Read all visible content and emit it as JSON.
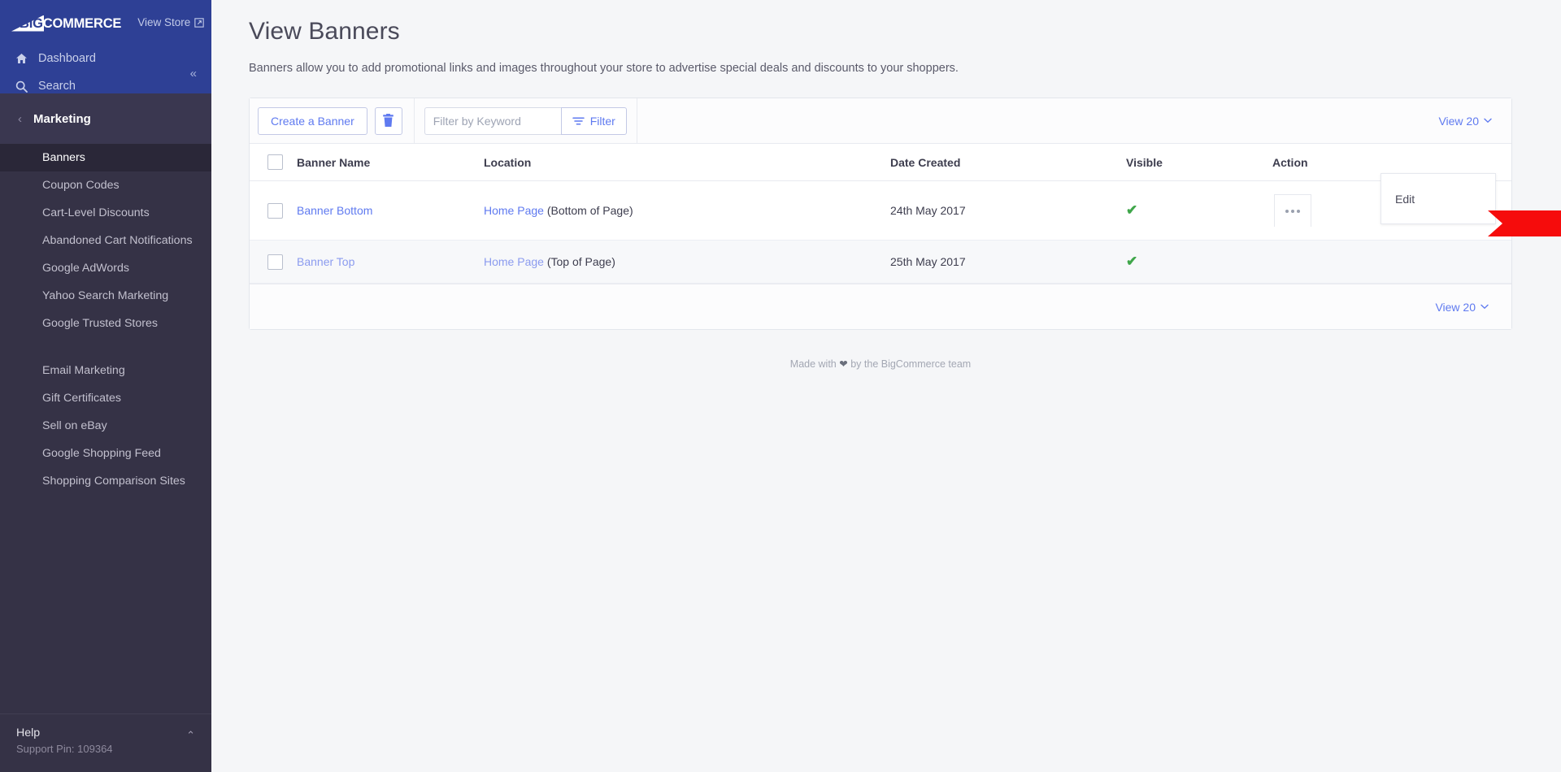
{
  "brand": {
    "logo_big": "BIG",
    "logo_commerce": "COMMERCE",
    "view_store": "View Store"
  },
  "sidebar": {
    "top_links": [
      {
        "label": "Dashboard",
        "icon": "home-icon"
      },
      {
        "label": "Search",
        "icon": "search-icon"
      }
    ],
    "collapse_icon": "«",
    "section": {
      "label": "Marketing",
      "back_icon": "‹"
    },
    "items": [
      {
        "label": "Banners",
        "active": true
      },
      {
        "label": "Coupon Codes",
        "active": false
      },
      {
        "label": "Cart-Level Discounts",
        "active": false
      },
      {
        "label": "Abandoned Cart Notifications",
        "active": false
      },
      {
        "label": "Google AdWords",
        "active": false
      },
      {
        "label": "Yahoo Search Marketing",
        "active": false
      },
      {
        "label": "Google Trusted Stores",
        "active": false
      }
    ],
    "items2": [
      {
        "label": "Email Marketing"
      },
      {
        "label": "Gift Certificates"
      },
      {
        "label": "Sell on eBay"
      },
      {
        "label": "Google Shopping Feed"
      },
      {
        "label": "Shopping Comparison Sites"
      }
    ],
    "help": {
      "title": "Help",
      "support_pin": "Support Pin: 109364",
      "chevron": "⌃"
    }
  },
  "page": {
    "title": "View Banners",
    "description": "Banners allow you to add promotional links and images throughout your store to advertise special deals and discounts to your shoppers."
  },
  "toolbar": {
    "create_label": "Create a Banner",
    "delete_icon": "trash-icon",
    "filter_placeholder": "Filter by Keyword",
    "filter_value": "",
    "filter_label": "Filter",
    "view_label": "View 20"
  },
  "table": {
    "columns": [
      "Banner Name",
      "Location",
      "Date Created",
      "Visible",
      "Action"
    ],
    "rows": [
      {
        "checked": false,
        "name": "Banner Bottom",
        "location_link": "Home Page",
        "location_extra": "(Bottom of Page)",
        "date": "24th May 2017",
        "visible": "✔",
        "hover": false
      },
      {
        "checked": false,
        "name": "Banner Top",
        "location_link": "Home Page",
        "location_extra": "(Top of Page)",
        "date": "25th May 2017",
        "visible": "✔",
        "hover": true
      }
    ]
  },
  "action_menu": {
    "edit_label": "Edit"
  },
  "footer": {
    "view_label": "View 20",
    "made_prefix": "Made with",
    "made_suffix": "by the BigCommerce team"
  },
  "colors": {
    "brand_blue": "#2e4095",
    "sidebar": "#353246",
    "link": "#5f7af0",
    "success": "#3fa64a",
    "arrow": "#f60c0c"
  }
}
